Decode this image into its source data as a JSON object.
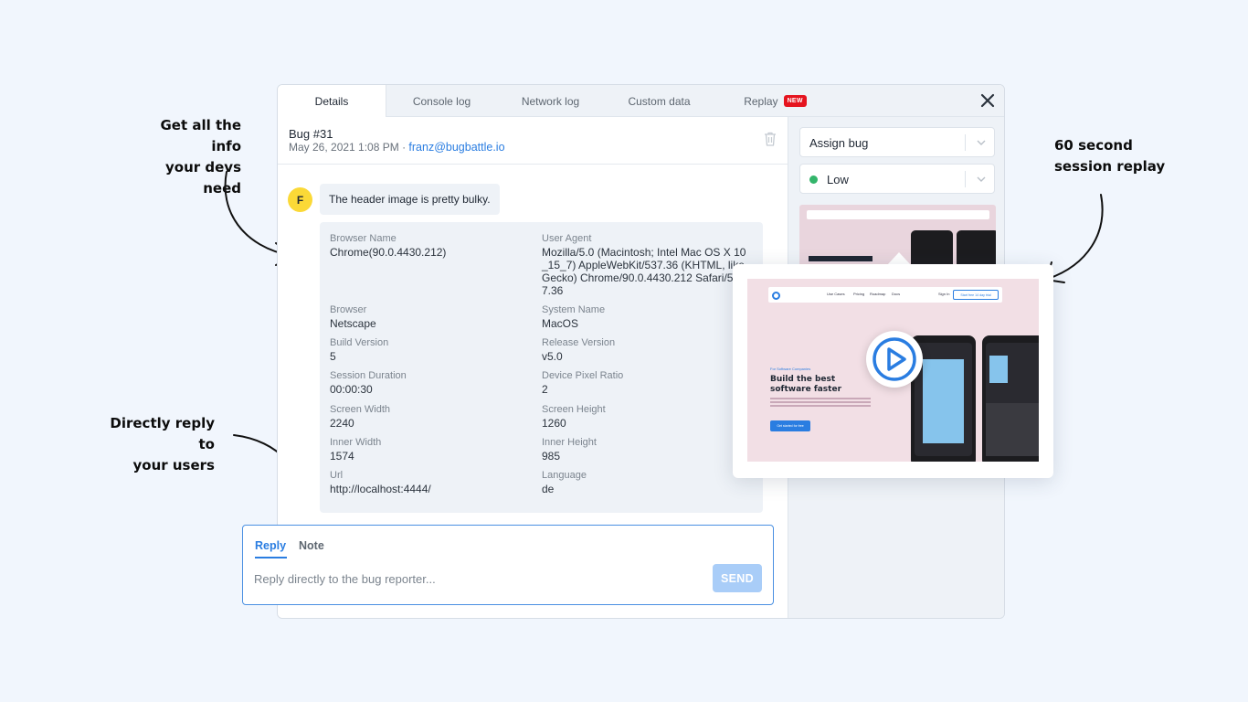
{
  "annotations": {
    "info": [
      "Get all the info",
      "your devs need"
    ],
    "replay": [
      "60 second",
      "session replay"
    ],
    "reply": [
      "Directly reply to",
      "your users"
    ]
  },
  "tabs": [
    {
      "label": "Details",
      "active": true
    },
    {
      "label": "Console log",
      "active": false
    },
    {
      "label": "Network log",
      "active": false
    },
    {
      "label": "Custom data",
      "active": false
    },
    {
      "label": "Replay",
      "active": false,
      "badge": "NEW"
    }
  ],
  "bug": {
    "title": "Bug #31",
    "date": "May 26, 2021 1:08 PM · ",
    "email": "franz@bugbattle.io"
  },
  "message": {
    "avatar_initial": "F",
    "text": "The header image is pretty bulky."
  },
  "details": [
    {
      "label": "Browser Name",
      "value": "Chrome(90.0.4430.212)"
    },
    {
      "label": "User Agent",
      "value": "Mozilla/5.0 (Macintosh; Intel Mac OS X 10_15_7) AppleWebKit/537.36 (KHTML, like Gecko) Chrome/90.0.4430.212 Safari/537.36"
    },
    {
      "label": "Browser",
      "value": "Netscape"
    },
    {
      "label": "System Name",
      "value": "MacOS"
    },
    {
      "label": "Build Version",
      "value": "5"
    },
    {
      "label": "Release Version",
      "value": "v5.0"
    },
    {
      "label": "Session Duration",
      "value": "00:00:30"
    },
    {
      "label": "Device Pixel Ratio",
      "value": "2"
    },
    {
      "label": "Screen Width",
      "value": "2240"
    },
    {
      "label": "Screen Height",
      "value": "1260"
    },
    {
      "label": "Inner Width",
      "value": "1574"
    },
    {
      "label": "Inner Height",
      "value": "985"
    },
    {
      "label": "Url",
      "value": "http://localhost:4444/"
    },
    {
      "label": "Language",
      "value": "de"
    }
  ],
  "sidebar": {
    "assign_label": "Assign bug",
    "priority_label": "Low",
    "priority_color": "#33b56b"
  },
  "preview": {
    "nav_items": [
      "Use Cases",
      "Pricing",
      "Roadmap",
      "Docs"
    ],
    "signin": "Sign In",
    "cta": "Start free 14 day trial",
    "eyebrow": "For Software Companies",
    "headline": "Build the best software faster",
    "button": "Get started for free"
  },
  "composer": {
    "tab_reply": "Reply",
    "tab_note": "Note",
    "placeholder": "Reply directly to the bug reporter...",
    "send_label": "SEND"
  },
  "colors": {
    "accent": "#2a7de1",
    "new_badge": "#e5141f",
    "avatar": "#fbd937",
    "background": "#f1f6fd"
  }
}
